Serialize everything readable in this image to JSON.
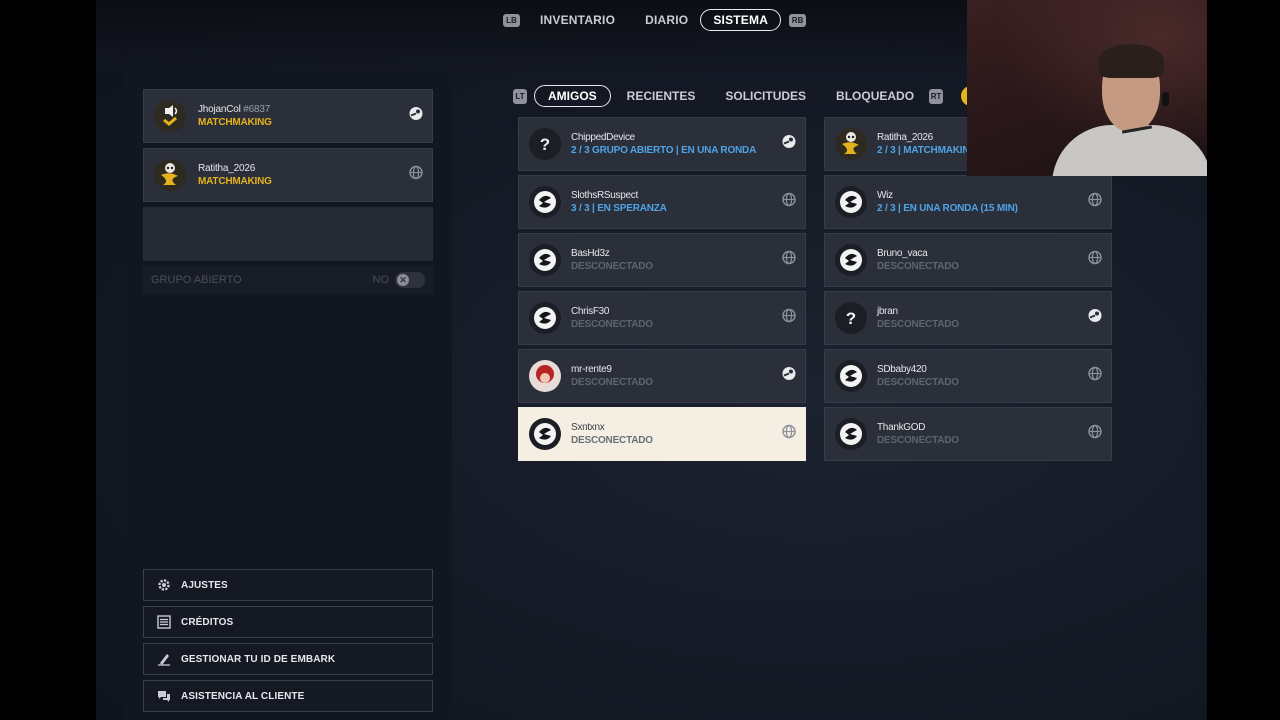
{
  "top_nav": {
    "left_hint": "LB",
    "tabs": [
      "INVENTARIO",
      "DIARIO",
      "SISTEMA"
    ],
    "active_tab": "SISTEMA",
    "right_hint": "RB"
  },
  "party": {
    "members": [
      {
        "name": "JhojanCol",
        "tag": "#6837",
        "status": "MATCHMAKING",
        "platform_icon": "steam-icon"
      },
      {
        "name": "Ratitha_2026",
        "tag": "",
        "status": "MATCHMAKING",
        "platform_icon": "globe-icon"
      }
    ],
    "open_group_label": "GRUPO ABIERTO",
    "open_group_value": "NO"
  },
  "menu": [
    {
      "label": "AJUSTES",
      "icon": "gear-icon"
    },
    {
      "label": "CRÉDITOS",
      "icon": "credits-icon"
    },
    {
      "label": "GESTIONAR TU ID DE EMBARK",
      "icon": "pen-icon"
    },
    {
      "label": "ASISTENCIA AL CLIENTE",
      "icon": "chat-icon"
    }
  ],
  "friends_tabs": {
    "left_hint": "LT",
    "tabs": [
      "AMIGOS",
      "RECIENTES",
      "SOLICITUDES",
      "BLOQUEADO"
    ],
    "active_tab": "AMIGOS",
    "right_hint": "RT"
  },
  "friends": [
    {
      "name": "ChippedDevice",
      "status": "2 / 3 GRUPO ABIERTO | EN UNA RONDA",
      "status_color": "blue",
      "avatar": "question",
      "platform": "steam-icon",
      "selected": false
    },
    {
      "name": "Ratitha_2026",
      "status": "2 / 3 | MATCHMAKING",
      "status_color": "blue",
      "avatar": "gold",
      "platform": "globe-icon",
      "selected": false
    },
    {
      "name": "SlothsRSuspect",
      "status": "3 / 3 | EN SPERANZA",
      "status_color": "blue",
      "avatar": "embark",
      "platform": "globe-icon",
      "selected": false
    },
    {
      "name": "Wiz",
      "status": "2 / 3 | EN UNA RONDA (15 MIN)",
      "status_color": "blue",
      "avatar": "embark",
      "platform": "globe-icon",
      "selected": false
    },
    {
      "name": "BasHd3z",
      "status": "DESCONECTADO",
      "status_color": "gray",
      "avatar": "embark",
      "platform": "globe-icon",
      "selected": false
    },
    {
      "name": "Bruno_vaca",
      "status": "DESCONECTADO",
      "status_color": "gray",
      "avatar": "embark",
      "platform": "globe-icon",
      "selected": false
    },
    {
      "name": "ChrisF30",
      "status": "DESCONECTADO",
      "status_color": "gray",
      "avatar": "embark",
      "platform": "globe-icon",
      "selected": false
    },
    {
      "name": "jbran",
      "status": "DESCONECTADO",
      "status_color": "gray",
      "avatar": "question",
      "platform": "steam-icon",
      "selected": false
    },
    {
      "name": "mr-rente9",
      "status": "DESCONECTADO",
      "status_color": "gray",
      "avatar": "photo",
      "platform": "steam-icon",
      "selected": false
    },
    {
      "name": "SDbaby420",
      "status": "DESCONECTADO",
      "status_color": "gray",
      "avatar": "embark",
      "platform": "globe-icon",
      "selected": false
    },
    {
      "name": "Sxntxnx",
      "status": "DESCONECTADO",
      "status_color": "gray",
      "avatar": "embark",
      "platform": "globe-icon",
      "selected": true
    },
    {
      "name": "ThankGOD",
      "status": "DESCONECTADO",
      "status_color": "gray",
      "avatar": "embark",
      "platform": "globe-icon",
      "selected": false
    }
  ],
  "colors": {
    "accent_gold": "#e5b21c",
    "status_blue": "#4fa3e6",
    "card_bg": "#2a2f3a",
    "selected_bg": "#f5efe3"
  }
}
